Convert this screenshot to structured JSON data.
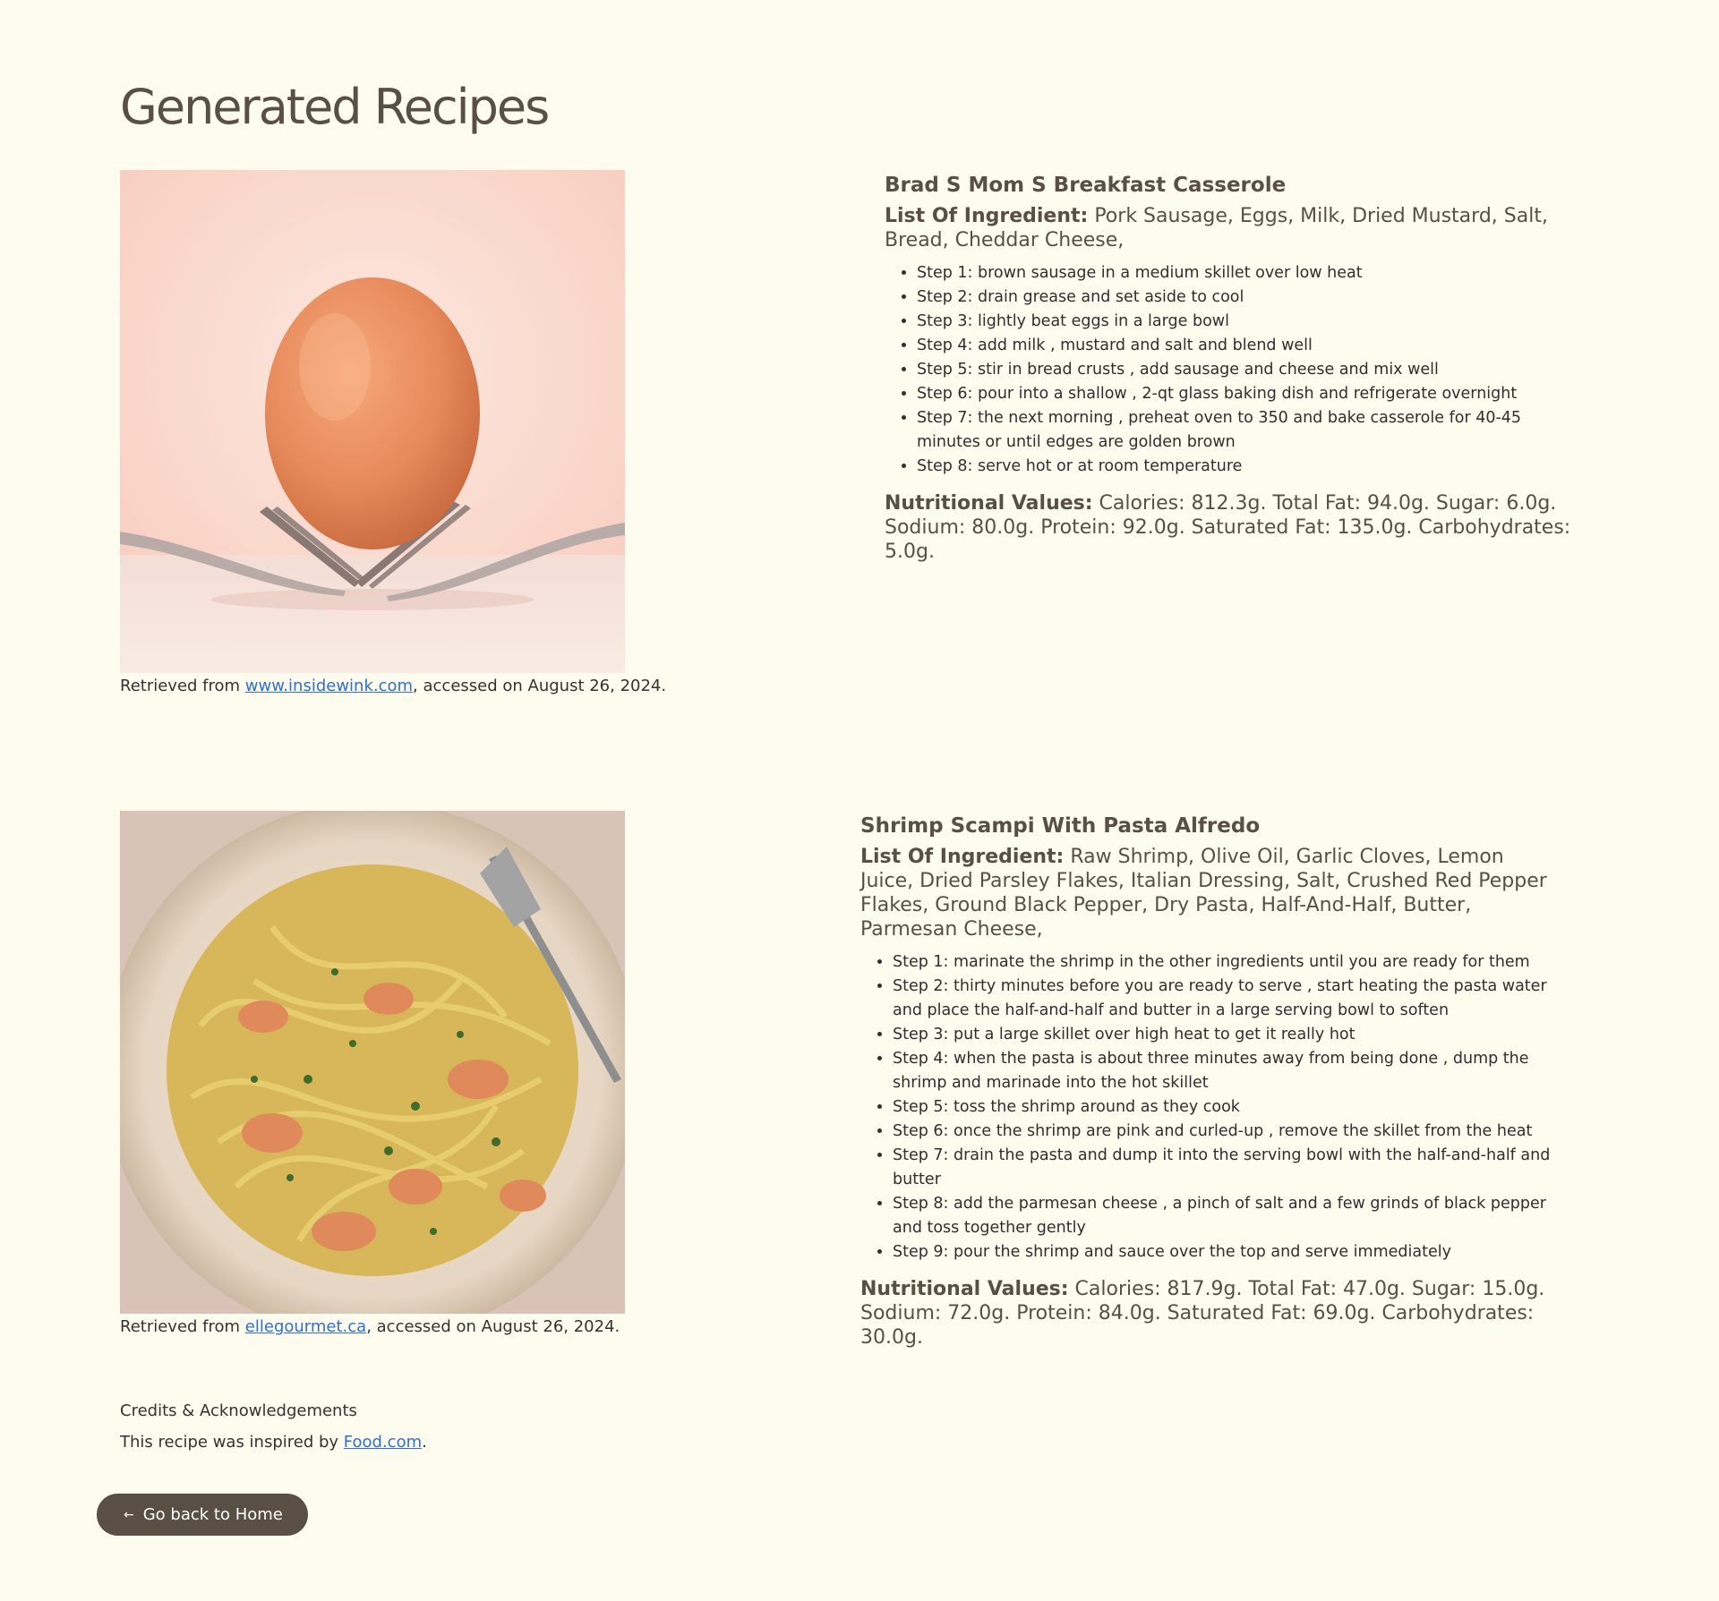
{
  "page": {
    "title": "Generated Recipes"
  },
  "recipes": [
    {
      "name": "Brad S Mom S Breakfast Casserole",
      "ingredients_label": "List Of Ingredient:",
      "ingredients": "Pork Sausage, Eggs, Milk, Dried Mustard, Salt, Bread, Cheddar Cheese,",
      "steps": [
        "Step 1: brown sausage in a medium skillet over low heat",
        "Step 2: drain grease and set aside to cool",
        "Step 3: lightly beat eggs in a large bowl",
        "Step 4: add milk , mustard and salt and blend well",
        "Step 5: stir in bread crusts , add sausage and cheese and mix well",
        "Step 6: pour into a shallow , 2-qt glass baking dish and refrigerate overnight",
        "Step 7: the next morning , preheat oven to 350 and bake casserole for 40-45 minutes or until edges are golden brown",
        "Step 8: serve hot or at room temperature"
      ],
      "nutrition_label": "Nutritional Values:",
      "nutrition": "Calories: 812.3g. Total Fat: 94.0g. Sugar: 6.0g. Sodium: 80.0g. Protein: 92.0g. Saturated Fat: 135.0g. Carbohydrates: 5.0g.",
      "caption_prefix": "Retrieved from ",
      "caption_link": "www.insidewink.com",
      "caption_suffix": ", accessed on August 26, 2024."
    },
    {
      "name": "Shrimp Scampi With Pasta Alfredo",
      "ingredients_label": "List Of Ingredient:",
      "ingredients": "Raw Shrimp, Olive Oil, Garlic Cloves, Lemon Juice, Dried Parsley Flakes, Italian Dressing, Salt, Crushed Red Pepper Flakes, Ground Black Pepper, Dry Pasta, Half-And-Half, Butter, Parmesan Cheese,",
      "steps": [
        "Step 1: marinate the shrimp in the other ingredients until you are ready for them",
        "Step 2: thirty minutes before you are ready to serve , start heating the pasta water and place the half-and-half and butter in a large serving bowl to soften",
        "Step 3: put a large skillet over high heat to get it really hot",
        "Step 4: when the pasta is about three minutes away from being done , dump the shrimp and marinade into the hot skillet",
        "Step 5: toss the shrimp around as they cook",
        "Step 6: once the shrimp are pink and curled-up , remove the skillet from the heat",
        "Step 7: drain the pasta and dump it into the serving bowl with the half-and-half and butter",
        "Step 8: add the parmesan cheese , a pinch of salt and a few grinds of black pepper and toss together gently",
        "Step 9: pour the shrimp and sauce over the top and serve immediately"
      ],
      "nutrition_label": "Nutritional Values:",
      "nutrition": "Calories: 817.9g. Total Fat: 47.0g. Sugar: 15.0g. Sodium: 72.0g. Protein: 84.0g. Saturated Fat: 69.0g. Carbohydrates: 30.0g.",
      "caption_prefix": "Retrieved from ",
      "caption_link": "ellegourmet.ca",
      "caption_suffix": ", accessed on August 26, 2024."
    }
  ],
  "credits": {
    "heading": "Credits & Acknowledgements",
    "text_prefix": "This recipe was inspired by ",
    "link": "Food.com",
    "text_suffix": "."
  },
  "back_button": {
    "arrow": "←",
    "label": "Go back to Home"
  },
  "colors": {
    "background": "#fefbef",
    "accent": "#5a4f44",
    "link": "#2f6fd1"
  }
}
